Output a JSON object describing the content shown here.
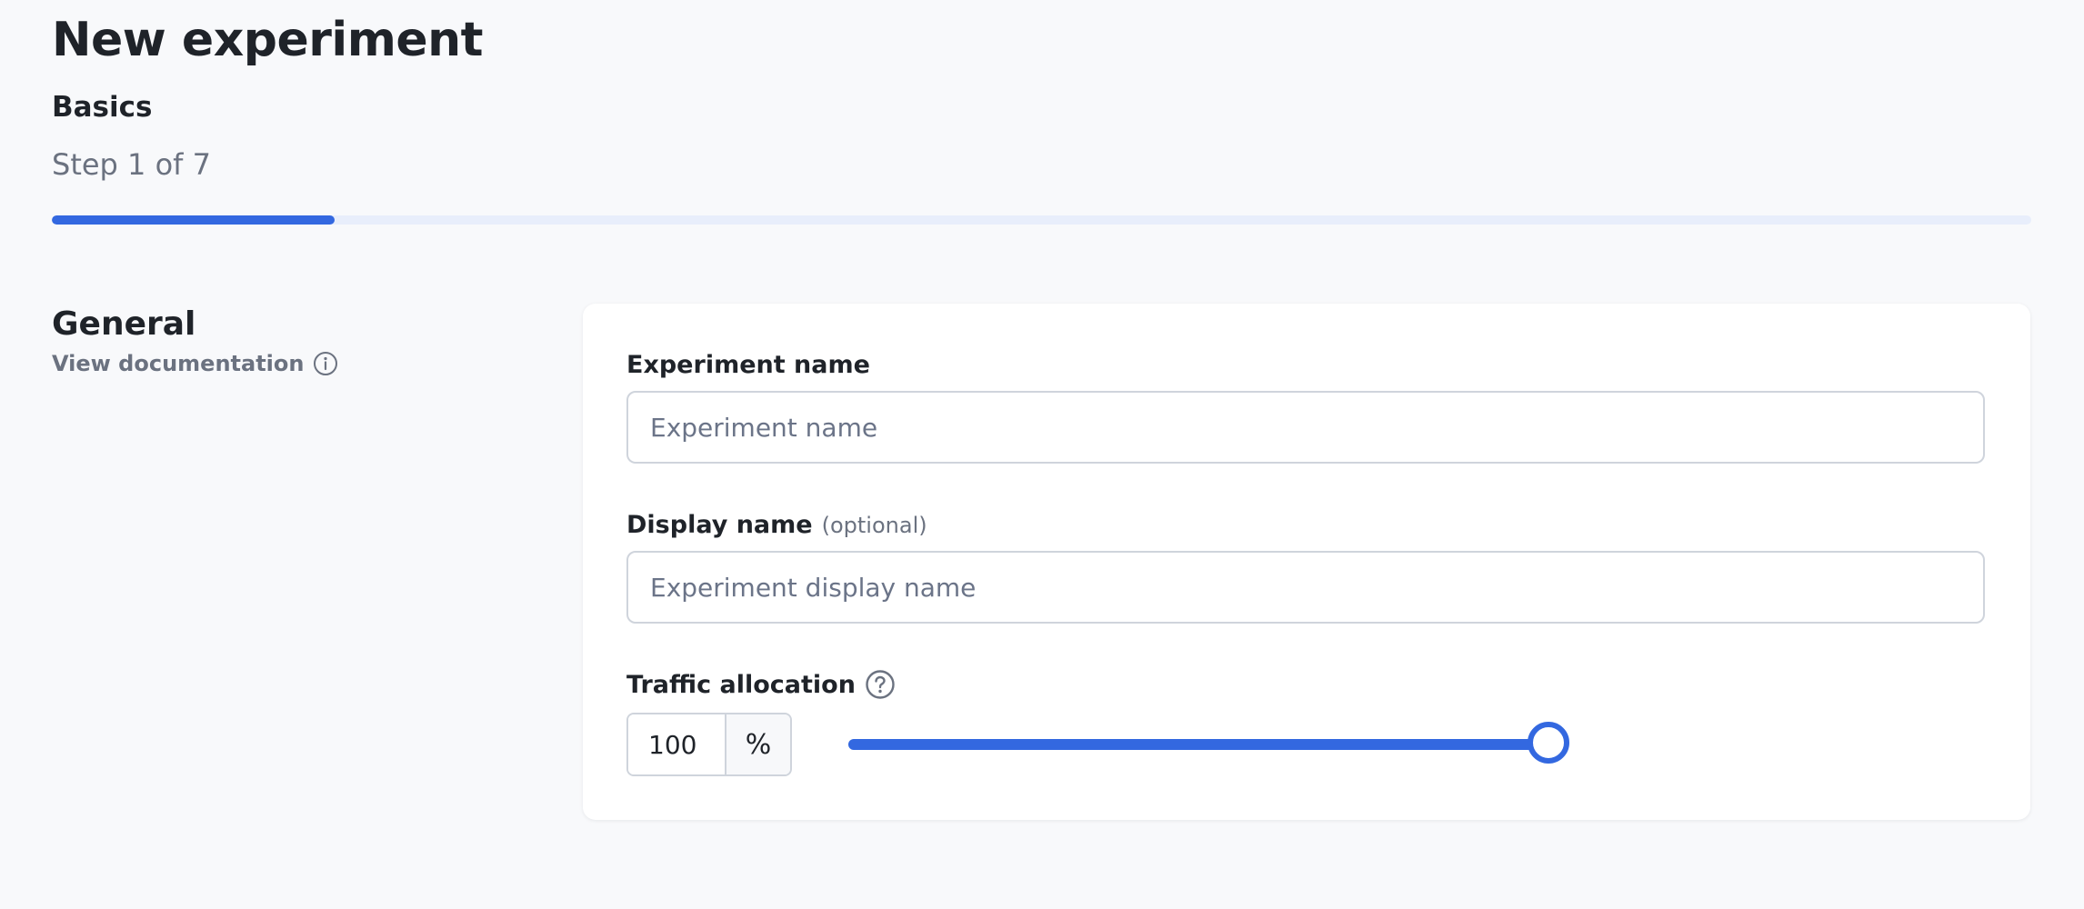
{
  "page": {
    "title": "New experiment",
    "step_name": "Basics",
    "step_count": "Step 1 of 7",
    "progress_fraction": 0.1428
  },
  "section": {
    "title": "General",
    "doc_link": "View documentation",
    "doc_icon": "info-circle-icon"
  },
  "form": {
    "experiment_name": {
      "label": "Experiment name",
      "placeholder": "Experiment name",
      "value": ""
    },
    "display_name": {
      "label": "Display name",
      "optional": "(optional)",
      "placeholder": "Experiment display name",
      "value": ""
    },
    "traffic_allocation": {
      "label": "Traffic allocation",
      "help_icon": "question-circle-icon",
      "value": "100",
      "unit": "%",
      "slider_percent": 100
    }
  },
  "colors": {
    "accent": "#3368e0",
    "background": "#f8f9fb",
    "card": "#ffffff",
    "muted_text": "#6b7280"
  }
}
